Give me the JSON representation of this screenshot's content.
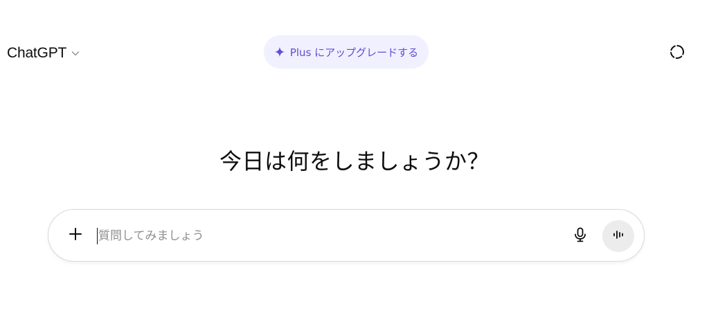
{
  "header": {
    "model_name": "ChatGPT",
    "model_chevron_icon": "chevron-down-icon",
    "upgrade_label": "Plus にアップグレードする",
    "upgrade_icon": "sparkle-icon",
    "temporary_chat_icon": "dashed-circle-icon"
  },
  "main": {
    "headline": "今日は何をしましょうか？"
  },
  "composer": {
    "placeholder": "質問してみましょう",
    "value": "",
    "attach_icon": "plus-icon",
    "dictate_icon": "microphone-icon",
    "voice_mode_icon": "voice-waveform-icon"
  },
  "colors": {
    "upgrade_bg": "#f1f0fe",
    "upgrade_accent": "#5a4fd6",
    "voice_btn_bg": "#ececec",
    "border": "#d9d9d9"
  }
}
